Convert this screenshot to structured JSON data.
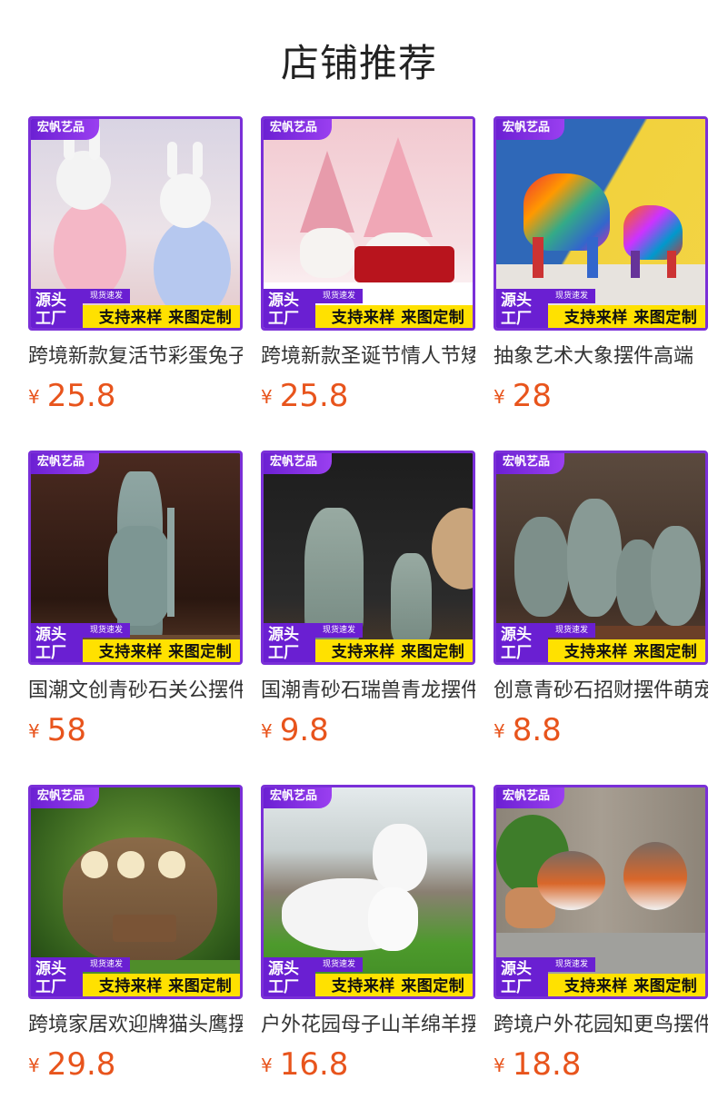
{
  "page": {
    "title": "店铺推荐"
  },
  "colors": {
    "accent": "#7a2fd8",
    "price": "#e8541c",
    "promo_bar": "#ffe100"
  },
  "badge": {
    "brand": "宏帆艺品",
    "source": "源头工厂",
    "source_line1": "源头",
    "source_line2": "工厂",
    "stock": "现货速发",
    "custom": "支持来样 来图定制"
  },
  "currency": "¥",
  "products": [
    {
      "name": "跨境新款复活节彩蛋兔子",
      "price": "25.8",
      "image": "easter-rabbit-eggs"
    },
    {
      "name": "跨境新款圣诞节情人节矮人",
      "price": "25.8",
      "image": "gnome-love-couple"
    },
    {
      "name": "抽象艺术大象摆件高端",
      "price": "28",
      "image": "graffiti-elephants"
    },
    {
      "name": "国潮文创青砂石关公摆件",
      "price": "58",
      "image": "guan-gong-statue"
    },
    {
      "name": "国潮青砂石瑞兽青龙摆件",
      "price": "9.8",
      "image": "dragon-beast"
    },
    {
      "name": "创意青砂石招财摆件萌宠",
      "price": "8.8",
      "image": "cute-monsters"
    },
    {
      "name": "跨境家居欢迎牌猫头鹰摆件",
      "price": "29.8",
      "image": "owl-welcome"
    },
    {
      "name": "户外花园母子山羊绵羊摆件",
      "price": "16.8",
      "image": "mother-sheep"
    },
    {
      "name": "跨境户外花园知更鸟摆件",
      "price": "18.8",
      "image": "robin-birds"
    }
  ]
}
